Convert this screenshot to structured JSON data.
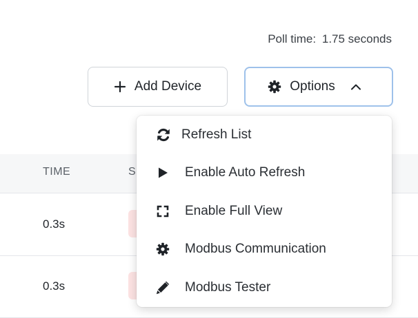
{
  "header": {
    "poll_label": "Poll time:",
    "poll_value": "1.75 seconds"
  },
  "toolbar": {
    "add_device_label": "Add Device",
    "options_label": "Options"
  },
  "table": {
    "columns": [
      "TIME",
      "S"
    ],
    "rows": [
      {
        "time": "0.3s"
      },
      {
        "time": "0.3s"
      }
    ]
  },
  "options_menu": {
    "items": [
      {
        "label": "Refresh List",
        "icon": "refresh-icon"
      },
      {
        "label": "Enable Auto Refresh",
        "icon": "play-icon"
      },
      {
        "label": "Enable Full View",
        "icon": "expand-icon"
      },
      {
        "label": "Modbus Communication",
        "icon": "gear-icon"
      },
      {
        "label": "Modbus Tester",
        "icon": "pen-icon"
      }
    ]
  },
  "colors": {
    "options_border": "#9ec1ea",
    "status_pill": "#fde3e3",
    "table_header_bg": "#f6f7f8"
  }
}
